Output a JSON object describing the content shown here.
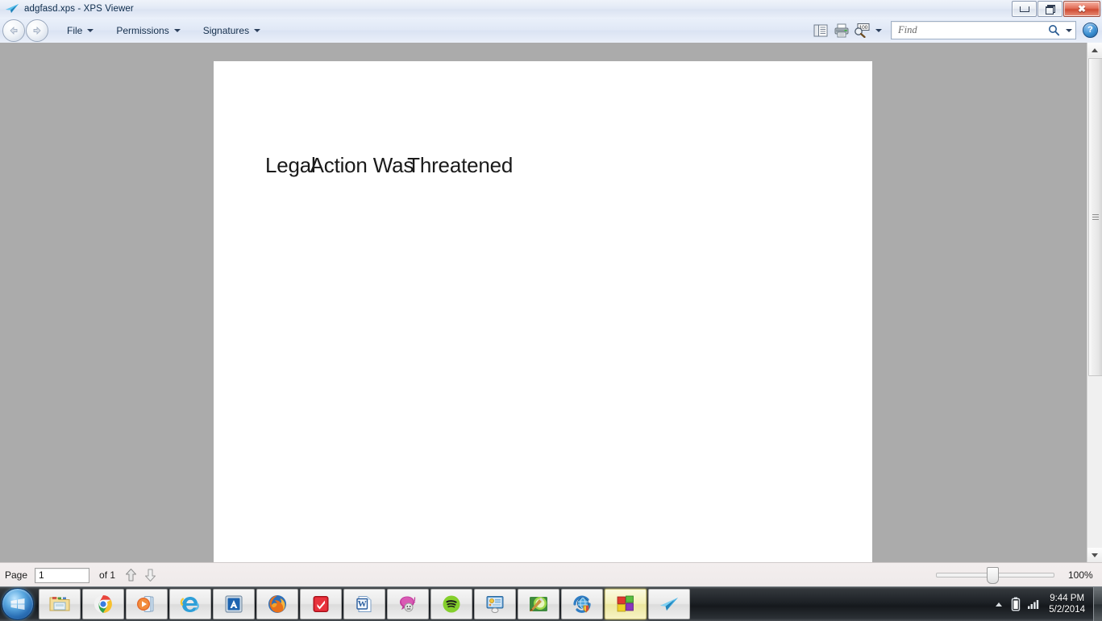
{
  "window": {
    "title": "adgfasd.xps - XPS Viewer",
    "app_icon": "xps-viewer-icon",
    "controls": {
      "minimize": "–",
      "restore": "❐",
      "close": "✕"
    }
  },
  "toolbar": {
    "nav": {
      "back": "back-arrow",
      "forward": "forward-arrow"
    },
    "menus": [
      {
        "label": "File",
        "name": "file"
      },
      {
        "label": "Permissions",
        "name": "permissions"
      },
      {
        "label": "Signatures",
        "name": "signatures"
      }
    ],
    "icons": [
      {
        "name": "page-layout-icon",
        "title": "Page layout"
      },
      {
        "name": "print-icon",
        "title": "Print"
      },
      {
        "name": "zoom-icon",
        "title": "Zoom",
        "badge": "100"
      }
    ],
    "zoom_caret": "chevron-down-icon",
    "find": {
      "placeholder": "Find",
      "value": "",
      "search_icon": "search-icon",
      "caret_icon": "chevron-down-icon"
    },
    "help": {
      "label": "?",
      "name": "help-icon"
    }
  },
  "document": {
    "text_words": [
      "Legal",
      "Action",
      "Was",
      "Threatened"
    ],
    "full_text": "Legal Action Was Threatened"
  },
  "scrollbar": {
    "up_arrow": "scroll-up-icon",
    "down_arrow": "scroll-down-icon"
  },
  "statusbar": {
    "page_label": "Page",
    "page_value": "1",
    "page_total": "of 1",
    "prev_page_icon": "arrow-up-icon",
    "next_page_icon": "arrow-down-icon",
    "zoom_percent": "100%"
  },
  "taskbar": {
    "start": "windows-start-orb",
    "items": [
      {
        "name": "file-explorer",
        "label": "Windows Explorer",
        "active": false
      },
      {
        "name": "google-chrome",
        "label": "Google Chrome",
        "active": false
      },
      {
        "name": "windows-media-player",
        "label": "Windows Media Player",
        "active": false
      },
      {
        "name": "internet-explorer",
        "label": "Internet Explorer",
        "active": false
      },
      {
        "name": "autodesk-app",
        "label": "A",
        "active": false
      },
      {
        "name": "mozilla-firefox",
        "label": "Mozilla Firefox",
        "active": false
      },
      {
        "name": "red-check-app",
        "label": "Checkmark App",
        "active": false
      },
      {
        "name": "microsoft-word",
        "label": "Microsoft Word",
        "active": false
      },
      {
        "name": "yahoo-messenger",
        "label": "Yahoo Messenger",
        "active": false
      },
      {
        "name": "spotify",
        "label": "Spotify",
        "active": false
      },
      {
        "name": "control-panel-app",
        "label": "Control Panel",
        "active": false
      },
      {
        "name": "paint-app",
        "label": "Paint",
        "active": false
      },
      {
        "name": "security-globe-app",
        "label": "Security Center",
        "active": false
      },
      {
        "name": "four-squares-app",
        "label": "Four Squares App",
        "active": true
      },
      {
        "name": "xps-viewer",
        "label": "XPS Viewer",
        "active": false
      }
    ],
    "tray": {
      "chevron": "show-hidden-icons",
      "battery": "battery-icon",
      "network": "network-signal-icon",
      "time": "9:44 PM",
      "date": "5/2/2014"
    }
  },
  "colors": {
    "titlebar": "#e3eaf6",
    "toolbar": "#e0e8f6",
    "doc_background": "#ababab",
    "page": "#ffffff",
    "statusbar": "#efeaea",
    "taskbar": "#1d2126",
    "close_button": "#cf4b33"
  }
}
